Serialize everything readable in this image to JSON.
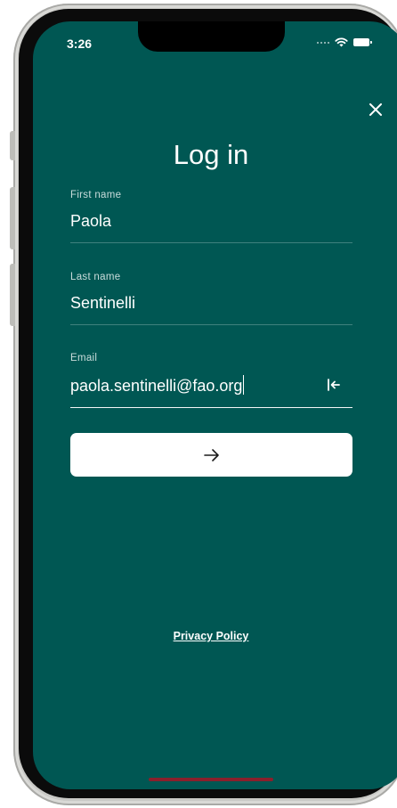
{
  "status_bar": {
    "time": "3:26"
  },
  "header": {
    "title": "Log in"
  },
  "form": {
    "first_name": {
      "label": "First name",
      "value": "Paola"
    },
    "last_name": {
      "label": "Last name",
      "value": "Sentinelli"
    },
    "email": {
      "label": "Email",
      "value": "paola.sentinelli@fao.org"
    }
  },
  "footer": {
    "privacy_link": "Privacy Policy"
  },
  "icons": {
    "close": "close-icon",
    "clear": "clear-field-icon",
    "submit": "arrow-right-icon",
    "wifi": "wifi-icon",
    "battery": "battery-icon",
    "signal": "signal-dots-icon"
  },
  "colors": {
    "background": "#005753",
    "button": "#ffffff",
    "text": "#ffffff",
    "home_indicator": "#8a1f2b"
  }
}
